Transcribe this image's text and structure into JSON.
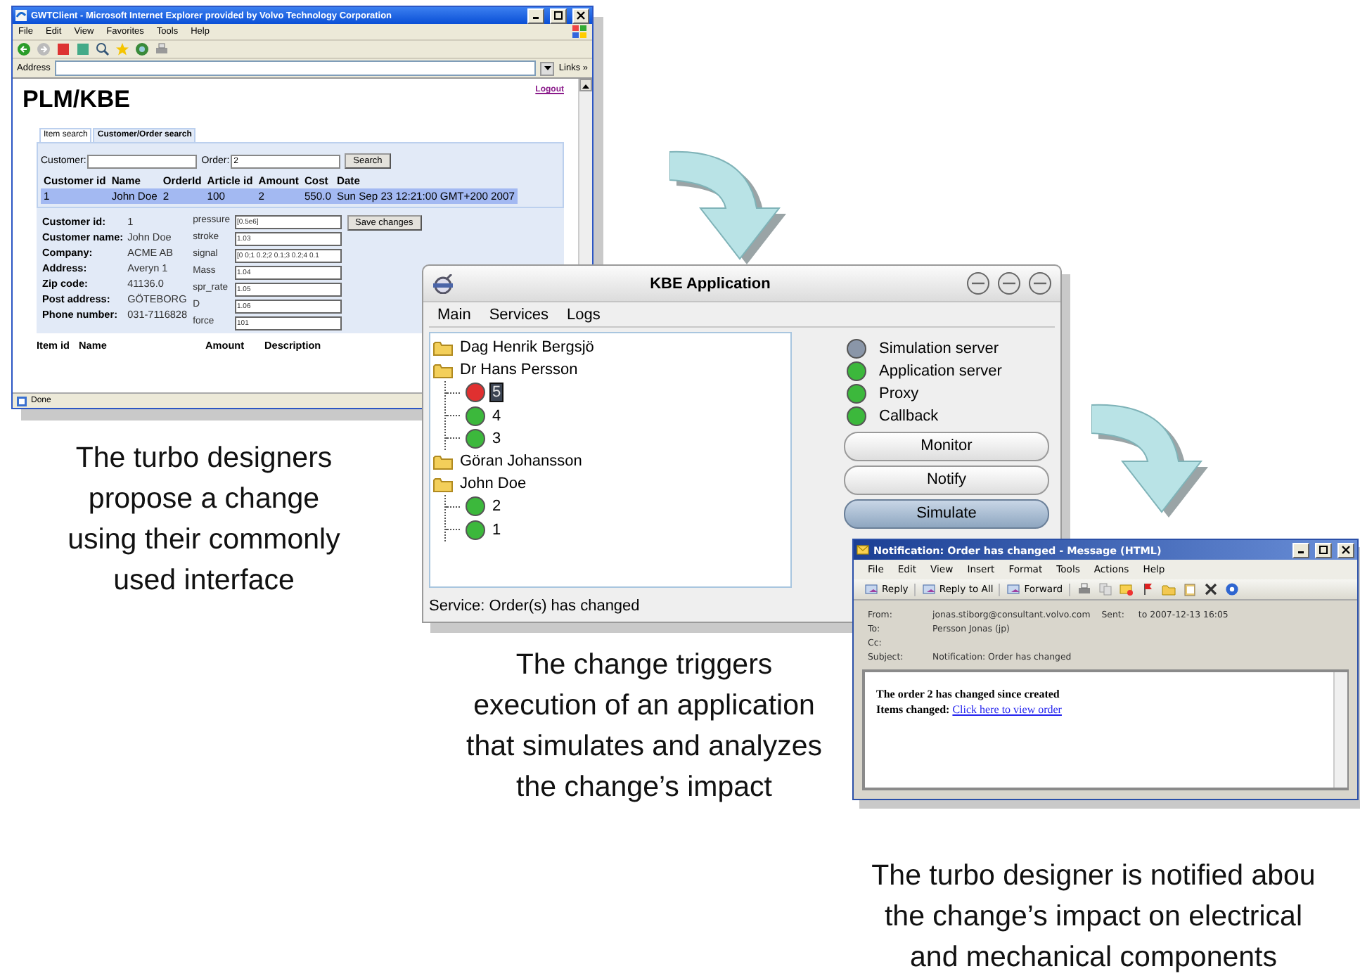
{
  "browser_window": {
    "title": "GWTClient - Microsoft Internet Explorer provided by Volvo Technology Corporation",
    "menu": [
      "File",
      "Edit",
      "View",
      "Favorites",
      "Tools",
      "Help"
    ],
    "address_label": "Address",
    "links": "Links »",
    "page_title": "PLM/KBE",
    "logout": "Logout",
    "tabs": [
      {
        "label": "Item search",
        "selected": false
      },
      {
        "label": "Customer/Order search",
        "selected": true
      }
    ],
    "search_form": {
      "customer_label": "Customer:",
      "order_label": "Order:",
      "order_value": "2",
      "button": "Search"
    },
    "orders_table": {
      "columns": [
        "Customer id",
        "Name",
        "OrderId",
        "Article id",
        "Amount",
        "Cost",
        "Date"
      ],
      "rows": [
        {
          "cells": [
            "1",
            "John Doe",
            "2",
            "100",
            "2",
            "550.0",
            "Sun Sep 23 12:21:00 GMT+200 2007"
          ],
          "selected": true
        }
      ]
    },
    "customer_details": [
      {
        "label": "Customer id:",
        "value": "1"
      },
      {
        "label": "Customer name:",
        "value": "John Doe"
      },
      {
        "label": "Company:",
        "value": "ACME AB"
      },
      {
        "label": "Address:",
        "value": "Averyn 1"
      },
      {
        "label": "Zip code:",
        "value": "41136.0"
      },
      {
        "label": "Post address:",
        "value": "GÖTEBORG"
      },
      {
        "label": "Phone number:",
        "value": "031-7116828"
      }
    ],
    "parameters": [
      {
        "name": "pressure",
        "value": "[0.5e6]"
      },
      {
        "name": "stroke",
        "value": "1.03"
      },
      {
        "name": "signal",
        "value": "[0 0;1 0.2;2 0.1;3 0.2;4 0.1"
      },
      {
        "name": "Mass",
        "value": "1.04"
      },
      {
        "name": "spr_rate",
        "value": "1.05"
      },
      {
        "name": "D",
        "value": "1.06"
      },
      {
        "name": "force",
        "value": "101"
      }
    ],
    "save_button": "Save changes",
    "items_table": {
      "columns": [
        "Item id",
        "Name",
        "Amount",
        "Description"
      ]
    },
    "status": "Done"
  },
  "kbe_window": {
    "title": "KBE Application",
    "menu": [
      "Main",
      "Services",
      "Logs"
    ],
    "tree": [
      {
        "label": "Dag Henrik Bergsjö",
        "kind": "folder",
        "selected": false
      },
      {
        "label": "Dr Hans Persson",
        "kind": "folder",
        "selected": false,
        "children": [
          {
            "label": "5",
            "kind": "order",
            "color": "#e03030",
            "selected": true
          },
          {
            "label": "4",
            "kind": "order",
            "color": "#3cb83c",
            "selected": false
          },
          {
            "label": "3",
            "kind": "order",
            "color": "#3cb83c",
            "selected": false
          }
        ]
      },
      {
        "label": "Göran Johansson",
        "kind": "folder",
        "selected": false
      },
      {
        "label": "John Doe",
        "kind": "folder",
        "selected": false,
        "children": [
          {
            "label": "2",
            "kind": "order",
            "color": "#3cb83c",
            "selected": false
          },
          {
            "label": "1",
            "kind": "order",
            "color": "#3cb83c",
            "selected": false
          }
        ]
      }
    ],
    "services": [
      {
        "name": "Simulation server",
        "color": "#8a96a8"
      },
      {
        "name": "Application server",
        "color": "#3cb83c"
      },
      {
        "name": "Proxy",
        "color": "#3cb83c"
      },
      {
        "name": "Callback",
        "color": "#3cb83c"
      }
    ],
    "buttons": [
      {
        "label": "Monitor",
        "pressed": false
      },
      {
        "label": "Notify",
        "pressed": false
      },
      {
        "label": "Simulate",
        "pressed": true
      }
    ],
    "status": "Service: Order(s) has changed"
  },
  "mail_window": {
    "title": "Notification: Order has changed - Message (HTML)",
    "menu": [
      "File",
      "Edit",
      "View",
      "Insert",
      "Format",
      "Tools",
      "Actions",
      "Help"
    ],
    "toolbar": [
      "Reply",
      "Reply to All",
      "Forward"
    ],
    "headers": [
      {
        "label": "From:",
        "value": "jonas.stiborg@consultant.volvo.com"
      },
      {
        "label": "Sent:",
        "value": "to 2007-12-13 16:05"
      },
      {
        "label": "To:",
        "value": "Persson Jonas (jp)"
      },
      {
        "label": "Cc:"
      },
      {
        "label": "Subject:",
        "value": "Notification: Order has changed"
      }
    ],
    "body_heading": "The order 2 has changed since created",
    "items_label": "Items changed:",
    "link": "Click here to view order"
  },
  "captions": [
    {
      "lines": [
        "The turbo designers",
        "propose a change",
        "using their commonly",
        "used interface"
      ]
    },
    {
      "lines": [
        "The change triggers",
        "execution of an application",
        "that simulates and analyzes",
        "the change’s impact"
      ]
    },
    {
      "lines": [
        "The turbo designer is notified abou",
        "the change’s impact on electrical",
        "and mechanical components"
      ]
    }
  ]
}
